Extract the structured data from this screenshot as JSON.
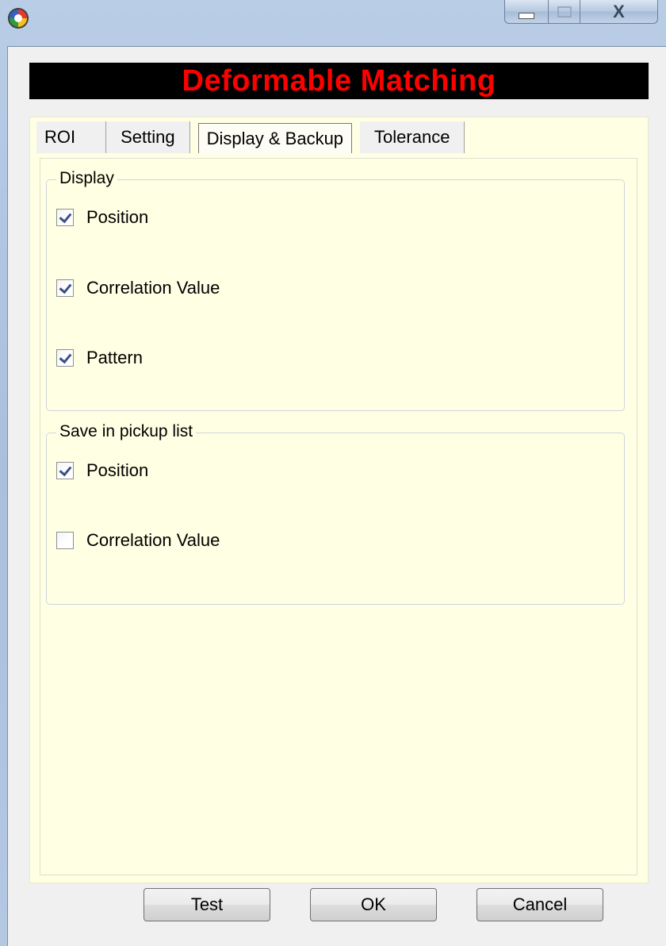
{
  "window": {
    "icon": "app-icon",
    "controls": {
      "close_label": "X"
    }
  },
  "banner": {
    "title": "Deformable Matching",
    "color": "#ff0000"
  },
  "tabs": [
    {
      "label": "ROI",
      "active": false
    },
    {
      "label": "Setting",
      "active": false
    },
    {
      "label": "Display & Backup",
      "active": true
    },
    {
      "label": "Tolerance",
      "active": false
    }
  ],
  "display_group": {
    "title": "Display",
    "items": [
      {
        "label": "Position",
        "checked": true
      },
      {
        "label": "Correlation Value",
        "checked": true
      },
      {
        "label": "Pattern",
        "checked": true
      }
    ]
  },
  "pickup_group": {
    "title": "Save in pickup list",
    "items": [
      {
        "label": "Position",
        "checked": true
      },
      {
        "label": "Correlation Value",
        "checked": false
      }
    ]
  },
  "buttons": {
    "test": "Test",
    "ok": "OK",
    "cancel": "Cancel"
  },
  "colors": {
    "panel_background": "#ffffe4",
    "banner_background": "#000000"
  }
}
